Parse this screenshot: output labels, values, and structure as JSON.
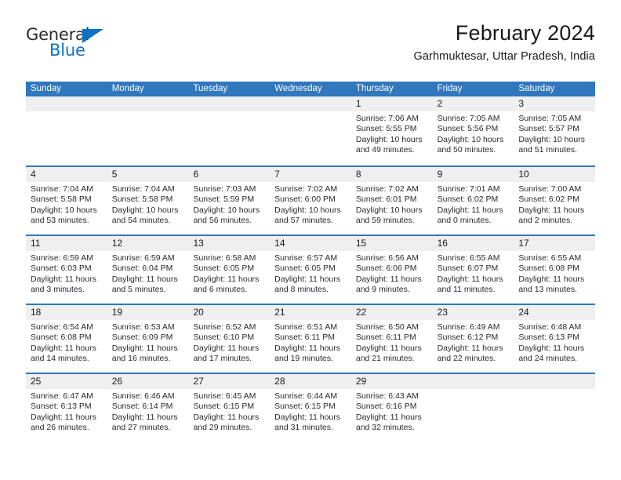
{
  "brand": {
    "name_part1": "General",
    "name_part2": "Blue",
    "accent_color": "#0d72c4"
  },
  "header": {
    "title": "February 2024",
    "subtitle": "Garhmuktesar, Uttar Pradesh, India"
  },
  "theme": {
    "header_blue": "#3077be",
    "day_band_gray": "#efefef",
    "text": "#1a1a1a"
  },
  "calendar": {
    "day_names": [
      "Sunday",
      "Monday",
      "Tuesday",
      "Wednesday",
      "Thursday",
      "Friday",
      "Saturday"
    ],
    "weeks": [
      [
        {
          "day": "",
          "empty": true
        },
        {
          "day": "",
          "empty": true
        },
        {
          "day": "",
          "empty": true
        },
        {
          "day": "",
          "empty": true
        },
        {
          "day": "1",
          "sunrise": "Sunrise: 7:06 AM",
          "sunset": "Sunset: 5:55 PM",
          "daylight": "Daylight: 10 hours and 49 minutes."
        },
        {
          "day": "2",
          "sunrise": "Sunrise: 7:05 AM",
          "sunset": "Sunset: 5:56 PM",
          "daylight": "Daylight: 10 hours and 50 minutes."
        },
        {
          "day": "3",
          "sunrise": "Sunrise: 7:05 AM",
          "sunset": "Sunset: 5:57 PM",
          "daylight": "Daylight: 10 hours and 51 minutes."
        }
      ],
      [
        {
          "day": "4",
          "sunrise": "Sunrise: 7:04 AM",
          "sunset": "Sunset: 5:58 PM",
          "daylight": "Daylight: 10 hours and 53 minutes."
        },
        {
          "day": "5",
          "sunrise": "Sunrise: 7:04 AM",
          "sunset": "Sunset: 5:58 PM",
          "daylight": "Daylight: 10 hours and 54 minutes."
        },
        {
          "day": "6",
          "sunrise": "Sunrise: 7:03 AM",
          "sunset": "Sunset: 5:59 PM",
          "daylight": "Daylight: 10 hours and 56 minutes."
        },
        {
          "day": "7",
          "sunrise": "Sunrise: 7:02 AM",
          "sunset": "Sunset: 6:00 PM",
          "daylight": "Daylight: 10 hours and 57 minutes."
        },
        {
          "day": "8",
          "sunrise": "Sunrise: 7:02 AM",
          "sunset": "Sunset: 6:01 PM",
          "daylight": "Daylight: 10 hours and 59 minutes."
        },
        {
          "day": "9",
          "sunrise": "Sunrise: 7:01 AM",
          "sunset": "Sunset: 6:02 PM",
          "daylight": "Daylight: 11 hours and 0 minutes."
        },
        {
          "day": "10",
          "sunrise": "Sunrise: 7:00 AM",
          "sunset": "Sunset: 6:02 PM",
          "daylight": "Daylight: 11 hours and 2 minutes."
        }
      ],
      [
        {
          "day": "11",
          "sunrise": "Sunrise: 6:59 AM",
          "sunset": "Sunset: 6:03 PM",
          "daylight": "Daylight: 11 hours and 3 minutes."
        },
        {
          "day": "12",
          "sunrise": "Sunrise: 6:59 AM",
          "sunset": "Sunset: 6:04 PM",
          "daylight": "Daylight: 11 hours and 5 minutes."
        },
        {
          "day": "13",
          "sunrise": "Sunrise: 6:58 AM",
          "sunset": "Sunset: 6:05 PM",
          "daylight": "Daylight: 11 hours and 6 minutes."
        },
        {
          "day": "14",
          "sunrise": "Sunrise: 6:57 AM",
          "sunset": "Sunset: 6:05 PM",
          "daylight": "Daylight: 11 hours and 8 minutes."
        },
        {
          "day": "15",
          "sunrise": "Sunrise: 6:56 AM",
          "sunset": "Sunset: 6:06 PM",
          "daylight": "Daylight: 11 hours and 9 minutes."
        },
        {
          "day": "16",
          "sunrise": "Sunrise: 6:55 AM",
          "sunset": "Sunset: 6:07 PM",
          "daylight": "Daylight: 11 hours and 11 minutes."
        },
        {
          "day": "17",
          "sunrise": "Sunrise: 6:55 AM",
          "sunset": "Sunset: 6:08 PM",
          "daylight": "Daylight: 11 hours and 13 minutes."
        }
      ],
      [
        {
          "day": "18",
          "sunrise": "Sunrise: 6:54 AM",
          "sunset": "Sunset: 6:08 PM",
          "daylight": "Daylight: 11 hours and 14 minutes."
        },
        {
          "day": "19",
          "sunrise": "Sunrise: 6:53 AM",
          "sunset": "Sunset: 6:09 PM",
          "daylight": "Daylight: 11 hours and 16 minutes."
        },
        {
          "day": "20",
          "sunrise": "Sunrise: 6:52 AM",
          "sunset": "Sunset: 6:10 PM",
          "daylight": "Daylight: 11 hours and 17 minutes."
        },
        {
          "day": "21",
          "sunrise": "Sunrise: 6:51 AM",
          "sunset": "Sunset: 6:11 PM",
          "daylight": "Daylight: 11 hours and 19 minutes."
        },
        {
          "day": "22",
          "sunrise": "Sunrise: 6:50 AM",
          "sunset": "Sunset: 6:11 PM",
          "daylight": "Daylight: 11 hours and 21 minutes."
        },
        {
          "day": "23",
          "sunrise": "Sunrise: 6:49 AM",
          "sunset": "Sunset: 6:12 PM",
          "daylight": "Daylight: 11 hours and 22 minutes."
        },
        {
          "day": "24",
          "sunrise": "Sunrise: 6:48 AM",
          "sunset": "Sunset: 6:13 PM",
          "daylight": "Daylight: 11 hours and 24 minutes."
        }
      ],
      [
        {
          "day": "25",
          "sunrise": "Sunrise: 6:47 AM",
          "sunset": "Sunset: 6:13 PM",
          "daylight": "Daylight: 11 hours and 26 minutes."
        },
        {
          "day": "26",
          "sunrise": "Sunrise: 6:46 AM",
          "sunset": "Sunset: 6:14 PM",
          "daylight": "Daylight: 11 hours and 27 minutes."
        },
        {
          "day": "27",
          "sunrise": "Sunrise: 6:45 AM",
          "sunset": "Sunset: 6:15 PM",
          "daylight": "Daylight: 11 hours and 29 minutes."
        },
        {
          "day": "28",
          "sunrise": "Sunrise: 6:44 AM",
          "sunset": "Sunset: 6:15 PM",
          "daylight": "Daylight: 11 hours and 31 minutes."
        },
        {
          "day": "29",
          "sunrise": "Sunrise: 6:43 AM",
          "sunset": "Sunset: 6:16 PM",
          "daylight": "Daylight: 11 hours and 32 minutes."
        },
        {
          "day": "",
          "empty": true
        },
        {
          "day": "",
          "empty": true
        }
      ]
    ]
  }
}
